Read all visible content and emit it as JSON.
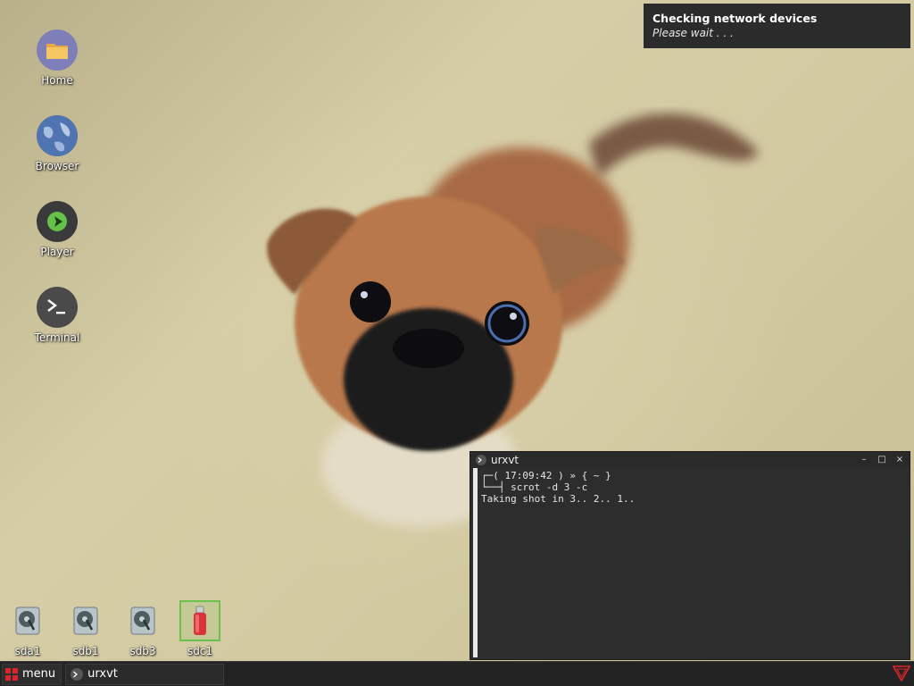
{
  "notification": {
    "title": "Checking network devices",
    "body": "Please wait . . ."
  },
  "desktop_icons": [
    {
      "label": "Home",
      "icon": "folder-icon"
    },
    {
      "label": "Browser",
      "icon": "globe-icon"
    },
    {
      "label": "Player",
      "icon": "play-icon"
    },
    {
      "label": "Terminal",
      "icon": "terminal-icon"
    }
  ],
  "drives": [
    {
      "label": "sda1",
      "icon": "hard-disk-icon"
    },
    {
      "label": "sdb1",
      "icon": "hard-disk-icon"
    },
    {
      "label": "sdb3",
      "icon": "hard-disk-icon"
    },
    {
      "label": "sdc1",
      "icon": "usb-drive-icon",
      "selected": true
    }
  ],
  "terminal": {
    "title": "urxvt",
    "line1": "┌─( 17:09:42 ) » { ~ }",
    "line2": "└──┤ scrot -d 3 -c",
    "line3": "Taking shot in 3.. 2.. 1..",
    "buttons": {
      "minimize": "–",
      "maximize": "□",
      "close": "×"
    }
  },
  "taskbar": {
    "menu_label": "menu",
    "task_label": "urxvt"
  },
  "colors": {
    "accent_green": "#6bc24a",
    "menu_red": "#d9252b",
    "panel": "#232323"
  }
}
